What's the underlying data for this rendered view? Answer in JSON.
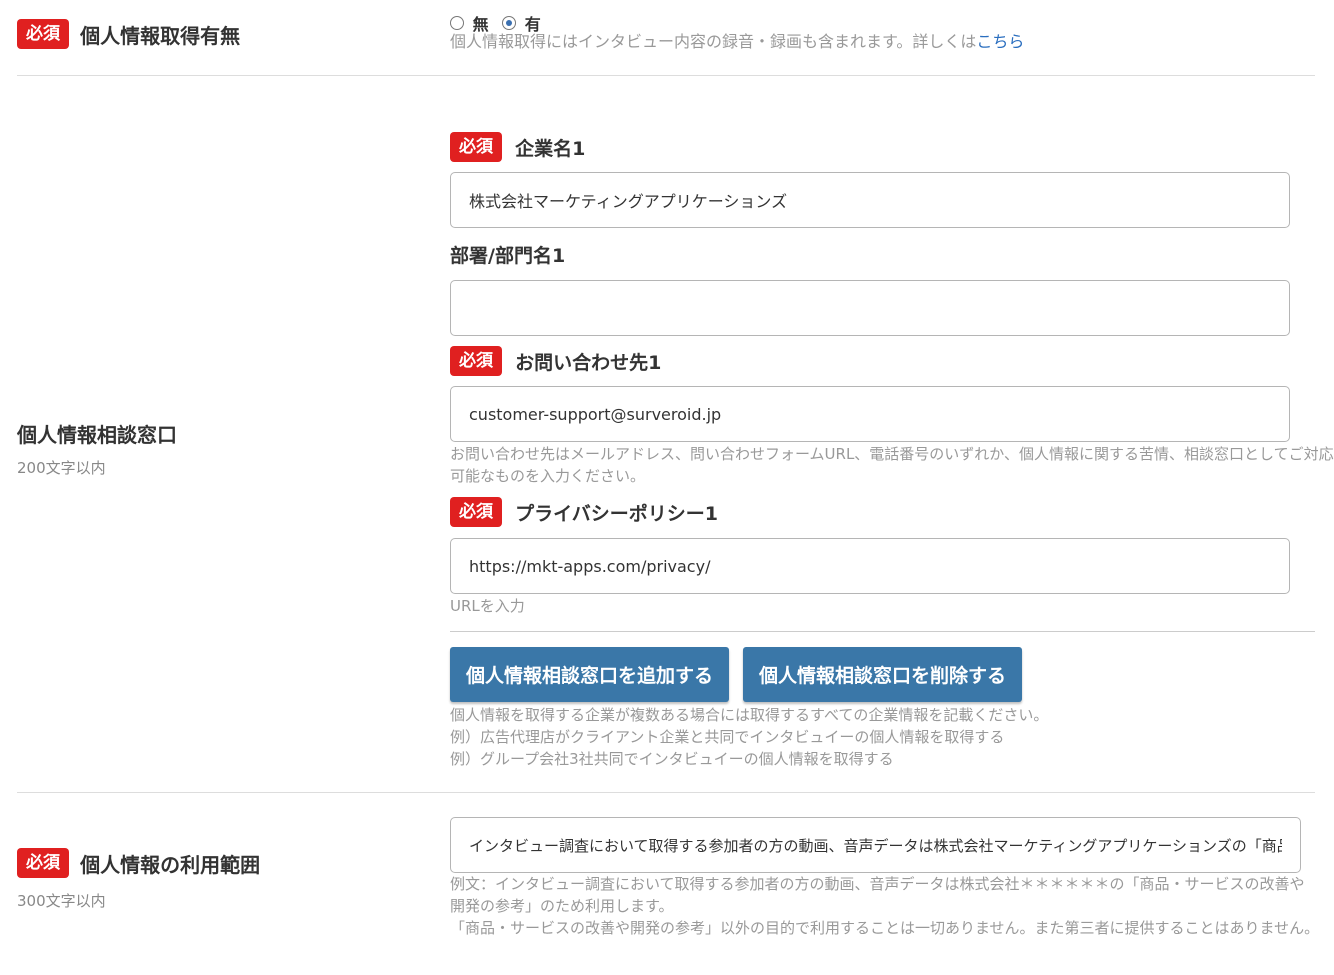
{
  "required_badge": "必須",
  "acquisition": {
    "label": "個人情報取得有無",
    "option_no": "無",
    "option_yes": "有",
    "selected": "有",
    "note": "個人情報取得にはインタビュー内容の録音・録画も含まれます。詳しくは",
    "note_link": "こちら"
  },
  "consultation": {
    "label": "個人情報相談窓口",
    "limit": "200文字以内",
    "company": {
      "label": "企業名1",
      "value": "株式会社マーケティングアプリケーションズ"
    },
    "department": {
      "label": "部署/部門名1",
      "value": ""
    },
    "contact": {
      "label": "お問い合わせ先1",
      "value": "customer-support@surveroid.jp",
      "hint_line1": "お問い合わせ先はメールアドレス、問い合わせフォームURL、電話番号のいずれか、個人情報に関する苦情、相談窓口としてご対応",
      "hint_line2": "可能なものを入力ください。"
    },
    "privacy": {
      "label": "プライバシーポリシー1",
      "value": "https://mkt-apps.com/privacy/",
      "hint": "URLを入力"
    },
    "add_button": "個人情報相談窓口を追加する",
    "delete_button": "個人情報相談窓口を削除する",
    "notes": [
      "個人情報を取得する企業が複数ある場合には取得するすべての企業情報を記載ください。",
      "例）広告代理店がクライアント企業と共同でインタビュイーの個人情報を取得する",
      "例）グループ会社3社共同でインタビュイーの個人情報を取得する"
    ]
  },
  "usage": {
    "label": "個人情報の利用範囲",
    "limit": "300文字以内",
    "value": "インタビュー調査において取得する参加者の方の動画、音声データは株式会社マーケティングアプリケーションズの「商品・サービスの改善や開発の参考」のため利用します。",
    "examples": [
      "例文：インタビュー調査において取得する参加者の方の動画、音声データは株式会社＊＊＊＊＊＊の「商品・サービスの改善や",
      "開発の参考」のため利用します。",
      "「商品・サービスの改善や開発の参考」以外の目的で利用することは一切ありません。また第三者に提供することはありません。"
    ]
  },
  "colors": {
    "badge": "#e02020",
    "button": "#3a77a8",
    "link": "#2a6ebf"
  }
}
